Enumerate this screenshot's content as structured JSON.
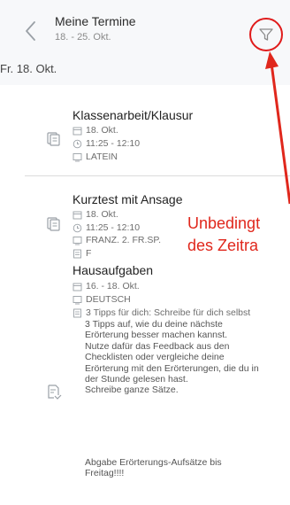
{
  "header": {
    "title": "Meine Termine",
    "subtitle": "18. - 25. Okt."
  },
  "day_label": "Fr. 18. Okt.",
  "cards": [
    {
      "title": "Klassenarbeit/Klausur",
      "date": "18. Okt.",
      "time": "11:25 - 12:10",
      "subject": "LATEIN"
    },
    {
      "title": "Kurztest mit Ansage",
      "date": "18. Okt.",
      "time": "11:25 - 12:10",
      "subject": "FRANZ. 2. FR.SP.",
      "note": "F"
    },
    {
      "title": "Hausaufgaben",
      "date": "16. - 18. Okt.",
      "subject": "DEUTSCH",
      "note_first": "3 Tipps für dich: Schreibe für dich selbst",
      "note_rest": "3 Tipps auf, wie du deine nächste\nErörterung besser machen kannst.\nNutze dafür das Feedback aus den\nChecklisten oder vergleiche deine\nErörterung mit den Erörterungen, die du in\nder Stunde gelesen hast.\nSchreibe ganze Sätze.",
      "note_last": "Abgabe Erörterungs-Aufsätze bis\nFreitag!!!!"
    }
  ],
  "annotation": {
    "line1": "Unbedingt",
    "line2": "des Zeitra",
    "color": "#e0271c"
  },
  "icons": {
    "back": "chevron-left-icon",
    "filter": "filter-icon",
    "calendar": "calendar-icon",
    "clock": "clock-icon",
    "subject": "subject-board-icon",
    "note": "note-icon",
    "exam": "exam-stack-icon",
    "homework": "homework-icon"
  }
}
